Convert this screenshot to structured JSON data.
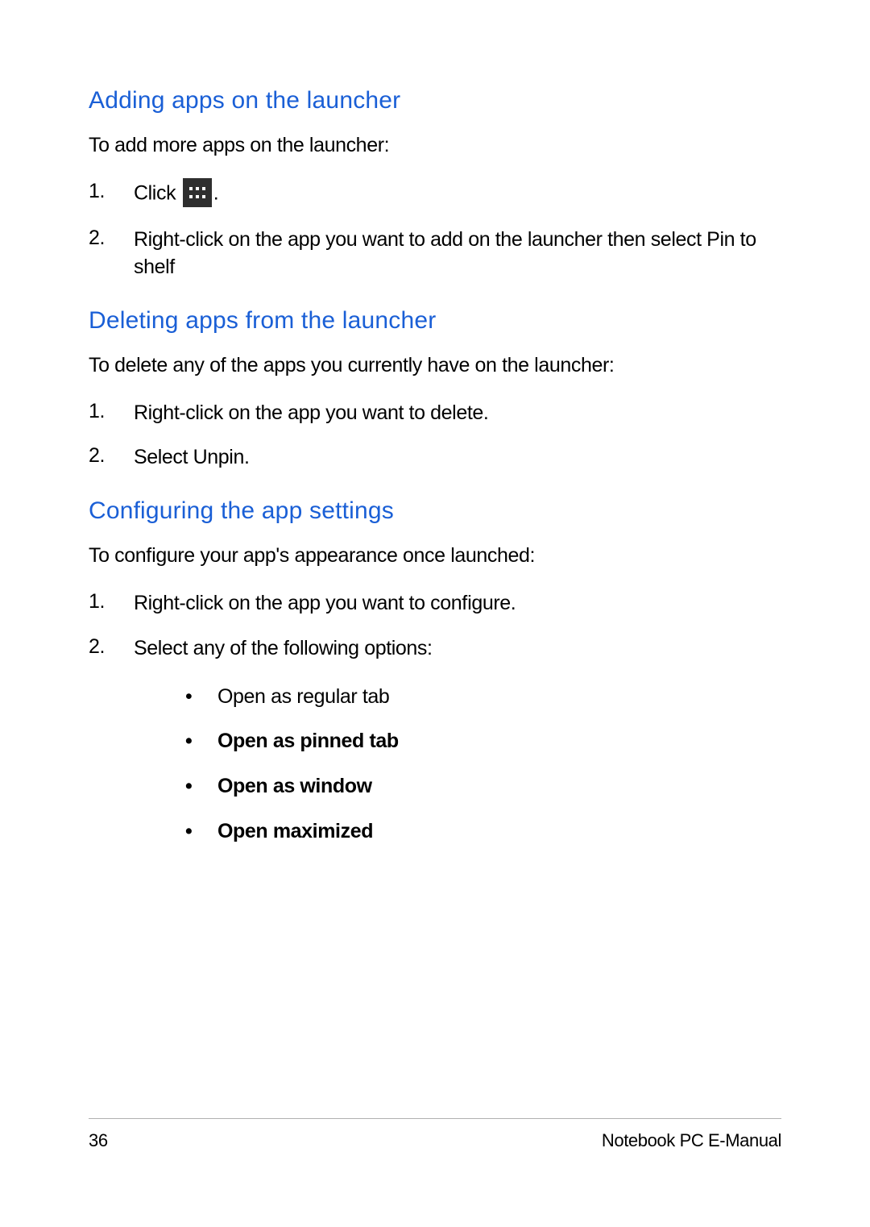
{
  "sections": [
    {
      "heading": "Adding apps on the launcher",
      "intro": "To add more apps on the launcher:",
      "steps": [
        {
          "num": "1.",
          "pre": "Click ",
          "icon": "apps-grid",
          "post": "."
        },
        {
          "num": "2.",
          "text": "Right-click on the app you want to add on the launcher then select Pin to shelf"
        }
      ]
    },
    {
      "heading": "Deleting apps from the launcher",
      "intro": "To delete any of the apps you currently have on the launcher:",
      "steps": [
        {
          "num": "1.",
          "text": "Right-click on the app you want to delete."
        },
        {
          "num": "2.",
          "text": "Select Unpin."
        }
      ]
    },
    {
      "heading": "Conﬁguring the app settings",
      "intro": "To conﬁgure your app's appearance once launched:",
      "steps": [
        {
          "num": "1.",
          "text": "Right-click on the app you want to conﬁgure."
        },
        {
          "num": "2.",
          "text": "Select any of the following options:"
        }
      ],
      "options": [
        {
          "bullet": "•",
          "text": "Open as regular tab",
          "bold": false
        },
        {
          "bullet": "•",
          "text": "Open as pinned tab",
          "bold": true
        },
        {
          "bullet": "•",
          "text": "Open as window",
          "bold": true
        },
        {
          "bullet": "•",
          "text": "Open maximized",
          "bold": true
        }
      ]
    }
  ],
  "footer": {
    "page_number": "36",
    "doc_title": "Notebook PC E-Manual"
  }
}
